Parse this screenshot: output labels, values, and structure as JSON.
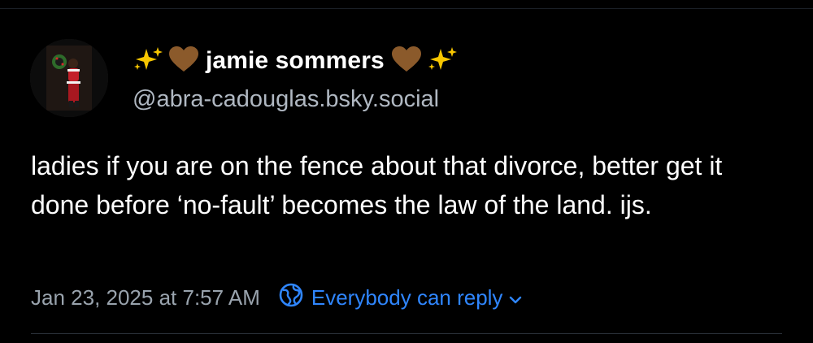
{
  "post": {
    "author": {
      "display_name": "jamie sommers",
      "handle": "@abra-cadouglas.bsky.social"
    },
    "text": "ladies if you are on the fence about that divorce, better get it done before ‘no-fault’ becomes the law of the land. ijs.",
    "timestamp": "Jan 23, 2025 at 7:57 AM",
    "reply_setting": "Everybody can reply"
  },
  "icons": {
    "name_prefix": [
      "sparkles-icon",
      "brown-heart-icon"
    ],
    "name_suffix": [
      "brown-heart-icon",
      "sparkles-icon"
    ],
    "reply_setting": "globe-icon",
    "reply_setting_chevron": "chevron-down-icon"
  },
  "colors": {
    "background": "#000000",
    "text": "#ffffff",
    "secondary_text": "#99a3ad",
    "accent": "#2f86ff",
    "heart": "#8b5a2b",
    "sparkle": "#f7c600"
  }
}
